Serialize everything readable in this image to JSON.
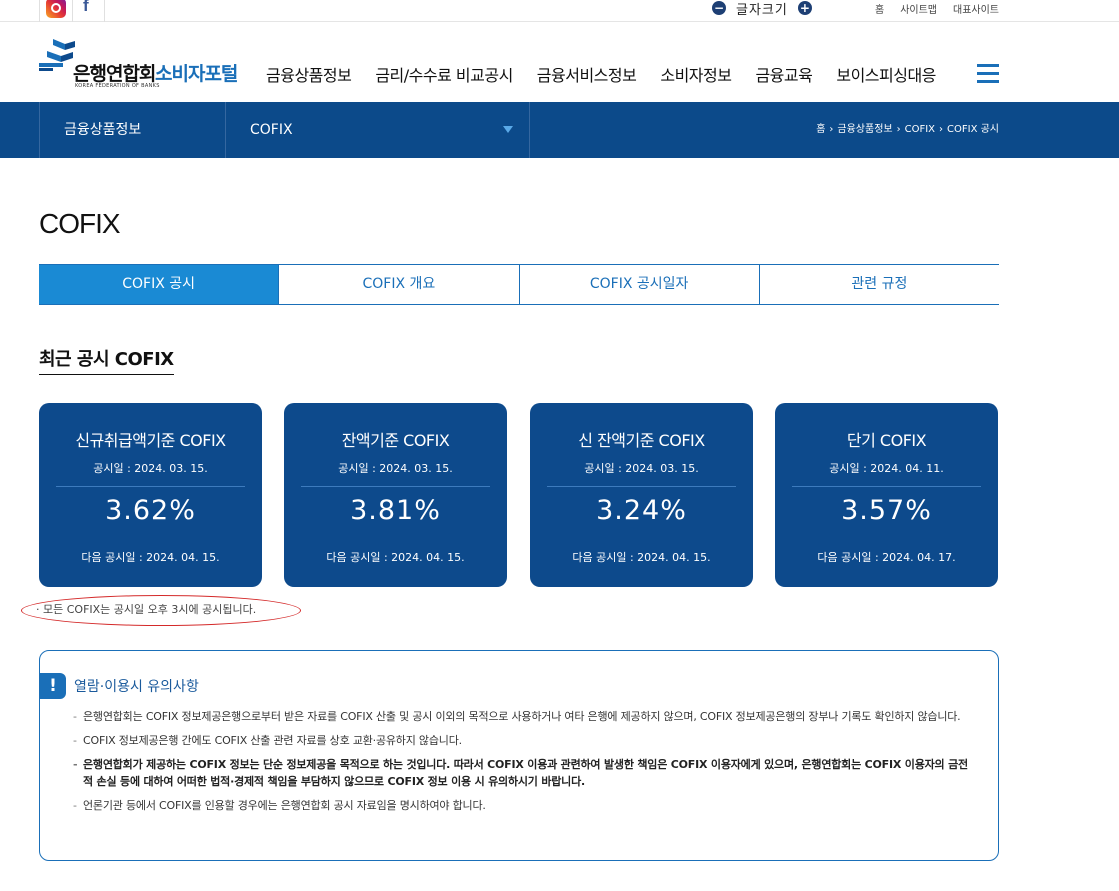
{
  "utility": {
    "font_size_label": "글자크기",
    "minus": "−",
    "plus": "+",
    "links": [
      "홈",
      "사이트맵",
      "대표사이트"
    ]
  },
  "logo": {
    "name": "은행연합회",
    "subtitle": "소비자포털",
    "english": "KOREA FEDERATION OF BANKS",
    "brand_color": "#1a6fb8"
  },
  "nav": [
    "금융상품정보",
    "금리/수수료 비교공시",
    "금융서비스정보",
    "소비자정보",
    "금융교육",
    "보이스피싱대응"
  ],
  "location": {
    "depth1": "금융상품정보",
    "depth2": "COFIX",
    "breadcrumb": [
      "홈",
      "금융상품정보",
      "COFIX",
      "COFIX 공시"
    ],
    "bar_color": "#0c4a8a"
  },
  "page_title": "COFIX",
  "tabs": [
    {
      "label": "COFIX 공시",
      "active": true
    },
    {
      "label": "COFIX 개요",
      "active": false
    },
    {
      "label": "COFIX 공시일자",
      "active": false
    },
    {
      "label": "관련 규정",
      "active": false
    }
  ],
  "section_title": "최근 공시 COFIX",
  "cards": [
    {
      "name": "신규취급액기준 COFIX",
      "date": "공시일 : 2024. 03. 15.",
      "rate": "3.62%",
      "next": "다음 공시일 : 2024. 04. 15."
    },
    {
      "name": "잔액기준 COFIX",
      "date": "공시일 : 2024. 03. 15.",
      "rate": "3.81%",
      "next": "다음 공시일 : 2024. 04. 15."
    },
    {
      "name": "신 잔액기준 COFIX",
      "date": "공시일 : 2024. 03. 15.",
      "rate": "3.24%",
      "next": "다음 공시일 : 2024. 04. 15."
    },
    {
      "name": "단기 COFIX",
      "date": "공시일 : 2024. 04. 11.",
      "rate": "3.57%",
      "next": "다음 공시일 : 2024. 04. 17."
    }
  ],
  "note": "· 모든 COFIX는 공시일 오후 3시에 공시됩니다.",
  "notice": {
    "title": "열람·이용시 유의사항",
    "icon": "!",
    "items": [
      {
        "text": "은행연합회는 COFIX 정보제공은행으로부터 받은 자료를 COFIX 산출 및 공시 이외의 목적으로 사용하거나 여타 은행에 제공하지 않으며, COFIX 정보제공은행의 장부나 기록도 확인하지 않습니다.",
        "bold": false
      },
      {
        "text": "COFIX 정보제공은행 간에도 COFIX 산출 관련 자료를 상호 교환·공유하지 않습니다.",
        "bold": false
      },
      {
        "text": "은행연합회가 제공하는 COFIX 정보는 단순 정보제공을 목적으로 하는 것입니다. 따라서 COFIX 이용과 관련하여 발생한 책임은 COFIX 이용자에게 있으며, 은행연합회는 COFIX 이용자의 금전적 손실 등에 대하여 어떠한 법적·경제적 책임을 부담하지 않으므로 COFIX 정보 이용 시 유의하시기 바랍니다.",
        "bold": true
      },
      {
        "text": "언론기관 등에서 COFIX를 인용할 경우에는 은행연합회 공시 자료임을 명시하여야 합니다.",
        "bold": false
      }
    ]
  }
}
